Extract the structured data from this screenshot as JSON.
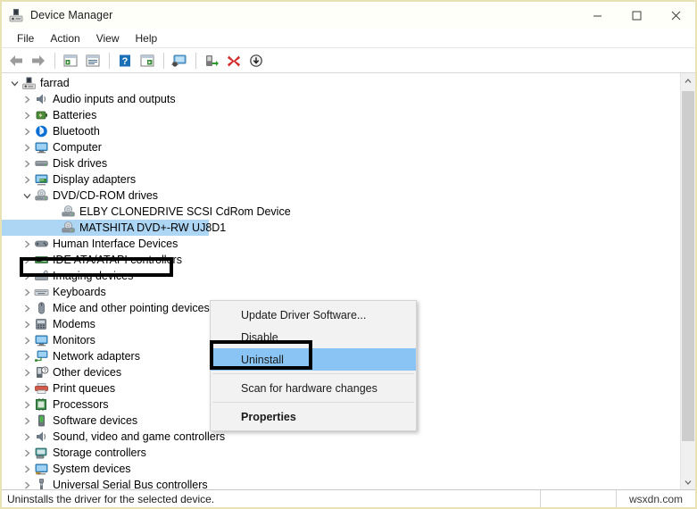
{
  "window": {
    "title": "Device Manager",
    "icon": "device-manager-icon",
    "controls": {
      "minimize": "minimize-icon",
      "maximize": "maximize-icon",
      "close": "close-icon"
    }
  },
  "menubar": {
    "items": [
      {
        "label": "File"
      },
      {
        "label": "Action"
      },
      {
        "label": "View"
      },
      {
        "label": "Help"
      }
    ]
  },
  "toolbar": {
    "buttons": [
      {
        "name": "back-icon"
      },
      {
        "name": "forward-icon"
      },
      {
        "name": "separator"
      },
      {
        "name": "show-hide-console-tree-icon"
      },
      {
        "name": "properties-icon"
      },
      {
        "name": "separator"
      },
      {
        "name": "help-icon"
      },
      {
        "name": "scan-for-hardware-changes-icon"
      },
      {
        "name": "separator"
      },
      {
        "name": "update-driver-icon"
      },
      {
        "name": "separator"
      },
      {
        "name": "enable-device-icon"
      },
      {
        "name": "uninstall-device-icon"
      },
      {
        "name": "disable-device-icon"
      }
    ]
  },
  "tree": {
    "items": [
      {
        "label": "farrad",
        "depth": 0,
        "expanded": true,
        "icon": "computer-icon",
        "selected": false
      },
      {
        "label": "Audio inputs and outputs",
        "depth": 1,
        "expanded": false,
        "icon": "speaker-icon",
        "selected": false
      },
      {
        "label": "Batteries",
        "depth": 1,
        "expanded": false,
        "icon": "battery-icon",
        "selected": false
      },
      {
        "label": "Bluetooth",
        "depth": 1,
        "expanded": false,
        "icon": "bluetooth-icon",
        "selected": false
      },
      {
        "label": "Computer",
        "depth": 1,
        "expanded": false,
        "icon": "monitor-icon",
        "selected": false
      },
      {
        "label": "Disk drives",
        "depth": 1,
        "expanded": false,
        "icon": "disk-drive-icon",
        "selected": false
      },
      {
        "label": "Display adapters",
        "depth": 1,
        "expanded": false,
        "icon": "display-adapter-icon",
        "selected": false
      },
      {
        "label": "DVD/CD-ROM drives",
        "depth": 1,
        "expanded": true,
        "icon": "dvd-drive-icon",
        "selected": false
      },
      {
        "label": "ELBY CLONEDRIVE SCSI CdRom Device",
        "depth": 2,
        "expanded": null,
        "icon": "dvd-drive-icon",
        "selected": false
      },
      {
        "label": "MATSHITA DVD+-RW UJ8D1",
        "depth": 2,
        "expanded": null,
        "icon": "dvd-drive-icon",
        "selected": true
      },
      {
        "label": "Human Interface Devices",
        "depth": 1,
        "expanded": false,
        "icon": "hid-icon",
        "selected": false
      },
      {
        "label": "IDE ATA/ATAPI controllers",
        "depth": 1,
        "expanded": false,
        "icon": "ide-controller-icon",
        "selected": false
      },
      {
        "label": "Imaging devices",
        "depth": 1,
        "expanded": false,
        "icon": "imaging-device-icon",
        "selected": false
      },
      {
        "label": "Keyboards",
        "depth": 1,
        "expanded": false,
        "icon": "keyboard-icon",
        "selected": false
      },
      {
        "label": "Mice and other pointing devices",
        "depth": 1,
        "expanded": false,
        "icon": "mouse-icon",
        "selected": false
      },
      {
        "label": "Modems",
        "depth": 1,
        "expanded": false,
        "icon": "modem-icon",
        "selected": false
      },
      {
        "label": "Monitors",
        "depth": 1,
        "expanded": false,
        "icon": "monitor-icon",
        "selected": false
      },
      {
        "label": "Network adapters",
        "depth": 1,
        "expanded": false,
        "icon": "network-adapter-icon",
        "selected": false
      },
      {
        "label": "Other devices",
        "depth": 1,
        "expanded": false,
        "icon": "unknown-device-icon",
        "selected": false
      },
      {
        "label": "Print queues",
        "depth": 1,
        "expanded": false,
        "icon": "printer-icon",
        "selected": false
      },
      {
        "label": "Processors",
        "depth": 1,
        "expanded": false,
        "icon": "processor-icon",
        "selected": false
      },
      {
        "label": "Software devices",
        "depth": 1,
        "expanded": false,
        "icon": "software-device-icon",
        "selected": false
      },
      {
        "label": "Sound, video and game controllers",
        "depth": 1,
        "expanded": false,
        "icon": "speaker-icon",
        "selected": false
      },
      {
        "label": "Storage controllers",
        "depth": 1,
        "expanded": false,
        "icon": "storage-controller-icon",
        "selected": false
      },
      {
        "label": "System devices",
        "depth": 1,
        "expanded": false,
        "icon": "system-device-icon",
        "selected": false
      },
      {
        "label": "Universal Serial Bus controllers",
        "depth": 1,
        "expanded": false,
        "icon": "usb-icon",
        "selected": false
      }
    ]
  },
  "context_menu": {
    "items": [
      {
        "label": "Update Driver Software...",
        "highlighted": false,
        "bold": false
      },
      {
        "label": "Disable",
        "highlighted": false,
        "bold": false
      },
      {
        "label": "Uninstall",
        "highlighted": true,
        "bold": false
      },
      {
        "label": "Scan for hardware changes",
        "highlighted": false,
        "bold": false
      },
      {
        "label": "Properties",
        "highlighted": false,
        "bold": true
      }
    ]
  },
  "statusbar": {
    "text": "Uninstalls the driver for the selected device.",
    "watermark": "wsxdn.com"
  },
  "annotations": [
    {
      "name": "dvd-cdrom-drives-highlight",
      "target": "DVD/CD-ROM drives"
    },
    {
      "name": "uninstall-menu-highlight",
      "target": "Uninstall"
    }
  ],
  "colors": {
    "selection": "#add6f5",
    "menu_highlight": "#89c4f4",
    "window_border": "#e9e2b4",
    "annotation": "#000000"
  }
}
